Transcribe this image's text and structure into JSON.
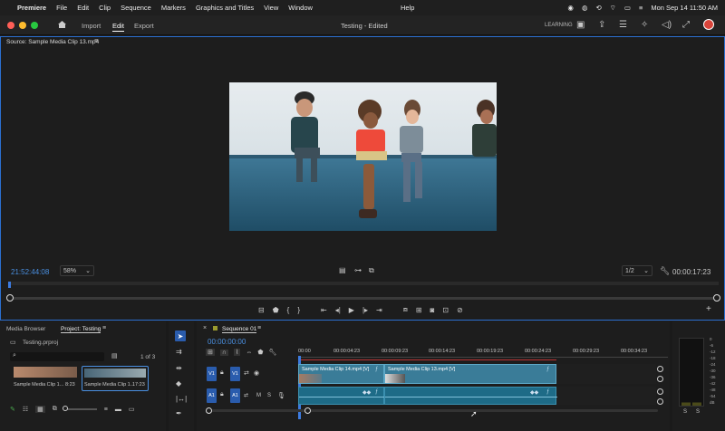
{
  "menubar": {
    "app": "Premiere",
    "items": [
      "File",
      "Edit",
      "Clip",
      "Sequence",
      "Markers",
      "Graphics and Titles",
      "View",
      "Window"
    ],
    "help": "Help",
    "datetime": "Mon Sep 14  11:50 AM"
  },
  "header": {
    "tabs": [
      "Import",
      "Edit",
      "Export"
    ],
    "active_tab": "Edit",
    "title": "Testing - Edited",
    "learning": "LEARNING"
  },
  "source": {
    "tab_label": "Source: Sample Media Clip 13.mp4",
    "timecode_left": "21:52:44:08",
    "zoom": "58%",
    "resolution": "1/2",
    "timecode_right": "00:00:17:23"
  },
  "project": {
    "tab_media_browser": "Media Browser",
    "tab_project": "Project: Testing",
    "project_file": "Testing.prproj",
    "paging": "1 of 3",
    "items": [
      {
        "name": "Sample Media Clip 1...",
        "duration": "8:23"
      },
      {
        "name": "Sample Media Clip 1...",
        "duration": "17:23"
      }
    ]
  },
  "timeline": {
    "tab": "Sequence 01",
    "timecode": "00:00:00:00",
    "ruler": [
      "00:00",
      "00:00:04:23",
      "00:00:09:23",
      "00:00:14:23",
      "00:00:19:23",
      "00:00:24:23",
      "00:00:29:23",
      "00:00:34:23"
    ],
    "tracks": {
      "v1": "V1",
      "a1": "A1",
      "m": "M",
      "s": "S"
    },
    "clips": [
      "Sample Media Clip 14.mp4 [V]",
      "Sample Media Clip 13.mp4 [V]"
    ]
  },
  "meters": {
    "labels": [
      "0",
      "-6",
      "-12",
      "-18",
      "-24",
      "-30",
      "-36",
      "-42",
      "-48",
      "-54",
      "dB"
    ],
    "s1": "S",
    "s2": "S"
  },
  "colors": {
    "accent": "#2b6fd0",
    "timecode_blue": "#4a90e2",
    "clip": "#3a7c98",
    "playhead": "#3d7be0"
  }
}
